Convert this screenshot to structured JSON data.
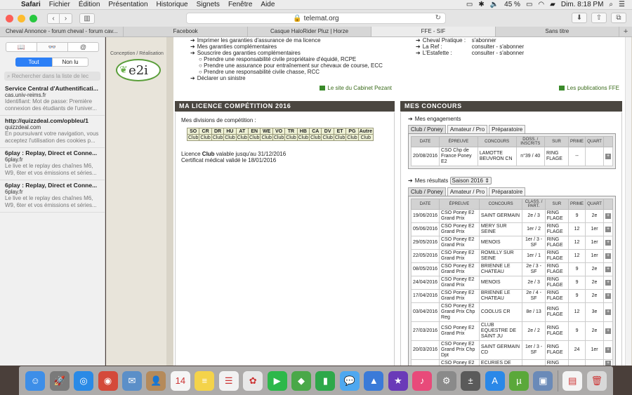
{
  "menubar": {
    "app": "Safari",
    "items": [
      "Fichier",
      "Édition",
      "Présentation",
      "Historique",
      "Signets",
      "Fenêtre",
      "Aide"
    ],
    "battery": "45 %",
    "clock": "Dim. 8:18 PM"
  },
  "toolbar": {
    "url": "telemat.org"
  },
  "tabs": [
    "Cheval Annonce - forum cheval - forum cav...",
    "Facebook",
    "Casque HaloRider Pluz | Horze",
    "FFE - SIF",
    "Sans titre"
  ],
  "sidebar": {
    "seg": [
      "📖",
      "👓",
      "@"
    ],
    "filters": [
      "Tout",
      "Non lu"
    ],
    "search_placeholder": "Rechercher dans la liste de lec",
    "items": [
      {
        "title": "Service Central d'Authentificati...",
        "url": "cas.univ-reims.fr",
        "desc": "Identifiant: Mot de passe: Première connexion des étudiants de l'univer..."
      },
      {
        "title": "http://quizzdeal.com/opbleu/1",
        "url": "quizzdeal.com",
        "desc": "En poursuivant votre navigation, vous acceptez l'utilisation des cookies p..."
      },
      {
        "title": "6play : Replay, Direct et Conne...",
        "url": "6play.fr",
        "desc": "Le live et le replay des chaînes M6, W9, 6ter et vos émissions et séries..."
      },
      {
        "title": "6play : Replay, Direct et Conne...",
        "url": "6play.fr",
        "desc": "Le live et le replay des chaînes M6, W9, 6ter et vos émissions et séries..."
      }
    ]
  },
  "page": {
    "conception": "Conception / Réalisation",
    "logo": "e2i",
    "assurance": {
      "items": [
        "Imprimer les garanties d'assurance de ma licence",
        "Mes garanties complémentaires",
        "Souscrire des garanties complémentaires"
      ],
      "subitems": [
        "Prendre une responsabilité civile propriétaire d'équidé, RCPE",
        "Prendre une assurance pour entraînement sur chevaux de course, ECC",
        "Prendre une responsabilité civile chasse, RCC"
      ],
      "last": "Déclarer un sinistre",
      "link": "Le site du Cabinet Pezant"
    },
    "publications": {
      "rows": [
        {
          "label": "Cheval Pratique :",
          "action": "s'abonner"
        },
        {
          "label": "La Ref :",
          "action": "consulter  -  s'abonner"
        },
        {
          "label": "L'Estafette :",
          "action": "consulter  -  s'abonner"
        }
      ],
      "link": "Les publications FFE"
    },
    "licence": {
      "header": "MA LICENCE COMPÉTITION 2016",
      "divisions_label": "Mes divisions de compétition :",
      "codes": [
        "SO",
        "CR",
        "DR",
        "HU",
        "AT",
        "EN",
        "WE",
        "VO",
        "TR",
        "HB",
        "CA",
        "DV",
        "ET",
        "PG",
        "Autre"
      ],
      "club": "Club",
      "valid_pre": "Licence ",
      "valid_club": "Club",
      "valid_post": " valable jusqu'au 31/12/2016",
      "certif": "Certificat médical validé le 18/01/2016"
    },
    "concours": {
      "header": "MES CONCOURS",
      "engagements_label": "Mes engagements",
      "tabs": [
        "Club / Poney",
        "Amateur / Pro",
        "Préparatoire"
      ],
      "eng_headers": [
        "Date",
        "Épreuve",
        "Concours",
        "Doss. / Inscrits",
        "Sur",
        "Prime",
        "Quart"
      ],
      "engagements": [
        {
          "date": "20/08/2016",
          "epreuve": "CSO Chp de France Poney E2",
          "concours": "LAMOTTE BEUVRON CN",
          "doss": "n°39 / 40",
          "sur": "RING FLAGE",
          "prime": "--",
          "quart": ""
        }
      ],
      "results_label": "Mes résultats",
      "saison": "Saison 2016",
      "res_headers": [
        "Date",
        "Épreuve",
        "Concours",
        "Class. / Part.",
        "Sur",
        "Prime",
        "Quart"
      ],
      "results": [
        {
          "date": "19/06/2016",
          "epreuve": "CSO Poney E2 Grand Prix",
          "concours": "SAINT GERMAIN",
          "class": "2e / 3",
          "sur": "RING FLAGE",
          "prime": "9",
          "quart": "2e"
        },
        {
          "date": "05/06/2016",
          "epreuve": "CSO Poney E2 Grand Prix",
          "concours": "MERY SUR SEINE",
          "class": "1er / 2",
          "sur": "RING FLAGE",
          "prime": "12",
          "quart": "1er"
        },
        {
          "date": "29/05/2016",
          "epreuve": "CSO Poney E2 Grand Prix",
          "concours": "MENOIS",
          "class": "1er / 3 - SF",
          "sur": "RING FLAGE",
          "prime": "12",
          "quart": "1er"
        },
        {
          "date": "22/05/2016",
          "epreuve": "CSO Poney E2 Grand Prix",
          "concours": "ROMILLY SUR SEINE",
          "class": "1er / 1",
          "sur": "RING FLAGE",
          "prime": "12",
          "quart": "1er"
        },
        {
          "date": "08/05/2016",
          "epreuve": "CSO Poney E2 Grand Prix",
          "concours": "BRIENNE LE CHATEAU",
          "class": "2e / 3 - SF",
          "sur": "RING FLAGE",
          "prime": "9",
          "quart": "2e"
        },
        {
          "date": "24/04/2016",
          "epreuve": "CSO Poney E2 Grand Prix",
          "concours": "MENOIS",
          "class": "2e / 3",
          "sur": "RING FLAGE",
          "prime": "9",
          "quart": "2e"
        },
        {
          "date": "17/04/2016",
          "epreuve": "CSO Poney E2 Grand Prix",
          "concours": "BRIENNE LE CHATEAU",
          "class": "2e / 4 - SF",
          "sur": "RING FLAGE",
          "prime": "9",
          "quart": "2e"
        },
        {
          "date": "03/04/2016",
          "epreuve": "CSO Poney E2 Grand Prix Chp Reg",
          "concours": "COOLUS CR",
          "class": "8e / 13",
          "sur": "RING FLAGE",
          "prime": "12",
          "quart": "3e"
        },
        {
          "date": "27/03/2016",
          "epreuve": "CSO Poney E2 Grand Prix",
          "concours": "CLUB EQUESTRE DE SAINT JU",
          "class": "2e / 2",
          "sur": "RING FLAGE",
          "prime": "9",
          "quart": "2e"
        },
        {
          "date": "20/03/2016",
          "epreuve": "CSO Poney E2 Grand Prix Chp Dpt",
          "concours": "SAINT GERMAIN CD",
          "class": "1er / 3 - SF",
          "sur": "RING FLAGE",
          "prime": "24",
          "quart": "1er"
        },
        {
          "date": "",
          "epreuve": "CSO Poney E2",
          "concours": "ECURIES DE",
          "class": "",
          "sur": "RING",
          "prime": "",
          "quart": ""
        }
      ]
    }
  },
  "dock": [
    {
      "name": "finder-icon",
      "color": "#3d8ee8",
      "glyph": "☺"
    },
    {
      "name": "launchpad-icon",
      "color": "#7a7a7a",
      "glyph": "🚀"
    },
    {
      "name": "safari-icon",
      "color": "#2a8ae6",
      "glyph": "◎"
    },
    {
      "name": "chrome-icon",
      "color": "#d44a3a",
      "glyph": "◉"
    },
    {
      "name": "preview-icon",
      "color": "#5b8fc8",
      "glyph": "✉"
    },
    {
      "name": "contacts-icon",
      "color": "#b58a5a",
      "glyph": "👤"
    },
    {
      "name": "calendar-icon",
      "color": "#f5f5f5",
      "glyph": "14"
    },
    {
      "name": "notes-icon",
      "color": "#f4d34a",
      "glyph": "≡"
    },
    {
      "name": "reminders-icon",
      "color": "#f2f2f2",
      "glyph": "☰"
    },
    {
      "name": "photos-icon",
      "color": "#e8e8e8",
      "glyph": "✿"
    },
    {
      "name": "facetime-icon",
      "color": "#2db84a",
      "glyph": "▶"
    },
    {
      "name": "maps-icon",
      "color": "#4aa848",
      "glyph": "◆"
    },
    {
      "name": "numbers-icon",
      "color": "#2ea84a",
      "glyph": "▮"
    },
    {
      "name": "messages-icon",
      "color": "#4ea8f0",
      "glyph": "💬"
    },
    {
      "name": "keynote-icon",
      "color": "#3a7ad8",
      "glyph": "▲"
    },
    {
      "name": "imovie-icon",
      "color": "#6a3ab8",
      "glyph": "★"
    },
    {
      "name": "itunes-icon",
      "color": "#e84a7a",
      "glyph": "♪"
    },
    {
      "name": "system-preferences-icon",
      "color": "#8a8a8a",
      "glyph": "⚙"
    },
    {
      "name": "calculator-icon",
      "color": "#5a5a5a",
      "glyph": "±"
    },
    {
      "name": "app-store-icon",
      "color": "#2a88e8",
      "glyph": "A"
    },
    {
      "name": "utorrent-icon",
      "color": "#5aa83a",
      "glyph": "µ"
    },
    {
      "name": "iphoto-icon",
      "color": "#6a8ab8",
      "glyph": "▣"
    },
    {
      "name": "document-icon",
      "color": "#f4f4f4",
      "glyph": "▤"
    },
    {
      "name": "trash-icon",
      "color": "#d8d8d8",
      "glyph": "🗑"
    }
  ],
  "colors": {
    "accent": "#2c7ff6",
    "header_bg": "#4a4640",
    "link_green": "#3a8a2a"
  }
}
